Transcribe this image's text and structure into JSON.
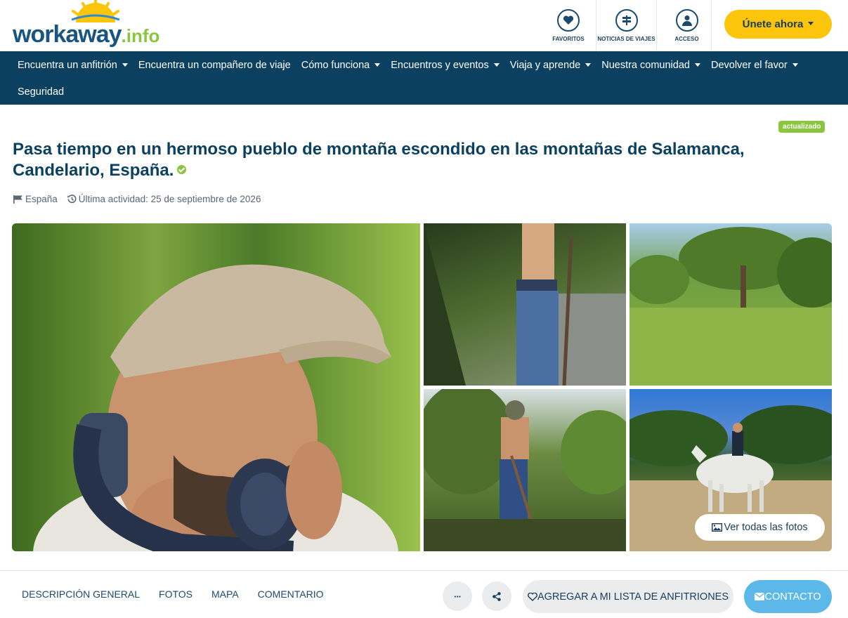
{
  "logo": {
    "brand": "workaway",
    "suffix": ".info"
  },
  "header": {
    "icons": [
      {
        "label": "FAVORITOS",
        "icon": "heart-icon"
      },
      {
        "label": "NOTICIAS DE VIAJES",
        "icon": "signpost-icon"
      },
      {
        "label": "ACCESO",
        "icon": "user-icon"
      }
    ],
    "join_label": "Únete ahora",
    "join_color": "#fcc40a"
  },
  "nav": {
    "items": [
      {
        "label": "Encuentra un anfitrión",
        "dropdown": true
      },
      {
        "label": "Encuentra un compañero de viaje",
        "dropdown": false
      },
      {
        "label": "Cómo funciona",
        "dropdown": true
      },
      {
        "label": "Encuentros y eventos",
        "dropdown": true
      },
      {
        "label": "Viaja y aprende",
        "dropdown": true
      },
      {
        "label": "Nuestra comunidad",
        "dropdown": true
      },
      {
        "label": "Devolver el favor",
        "dropdown": true
      },
      {
        "label": "Seguridad",
        "dropdown": false
      }
    ],
    "background": "#0c4060"
  },
  "listing": {
    "badge": "actualizado",
    "title": "Pasa tiempo en un hermoso pueblo de montaña escondido en las montañas de Salamanca, Candelario, España.",
    "country": "España",
    "last_activity": "Última actividad: 25 de septiembre de 2026",
    "see_all_photos": "Ver todas las fotos"
  },
  "bottom_bar": {
    "tabs": [
      "DESCRIPCIÓN GENERAL",
      "FOTOS",
      "MAPA",
      "COMENTARIO"
    ],
    "more_label": "···",
    "add_list_label": "AGREGAR A MI LISTA DE ANFITRIONES",
    "contact_label": "CONTACTO",
    "contact_color": "#5bb8e8"
  }
}
